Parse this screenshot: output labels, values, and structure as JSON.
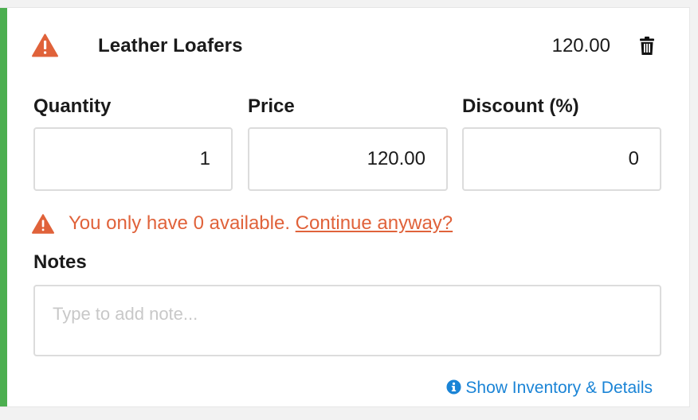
{
  "line_item": {
    "product_name": "Leather Loafers",
    "line_total": "120.00",
    "status_color": "#4caf50"
  },
  "fields": {
    "quantity": {
      "label": "Quantity",
      "value": "1"
    },
    "price": {
      "label": "Price",
      "value": "120.00"
    },
    "discount": {
      "label": "Discount (%)",
      "value": "0"
    }
  },
  "stock_warning": {
    "message": "You only have 0 available.",
    "action_label": "Continue anyway?",
    "color": "#e0623a"
  },
  "notes": {
    "label": "Notes",
    "placeholder": "Type to add note...",
    "value": ""
  },
  "details_link": {
    "label": "Show Inventory & Details",
    "icon": "info-icon",
    "color": "#1a84d6"
  },
  "icons": {
    "header_warning": "warning-icon",
    "delete": "trash-icon"
  }
}
